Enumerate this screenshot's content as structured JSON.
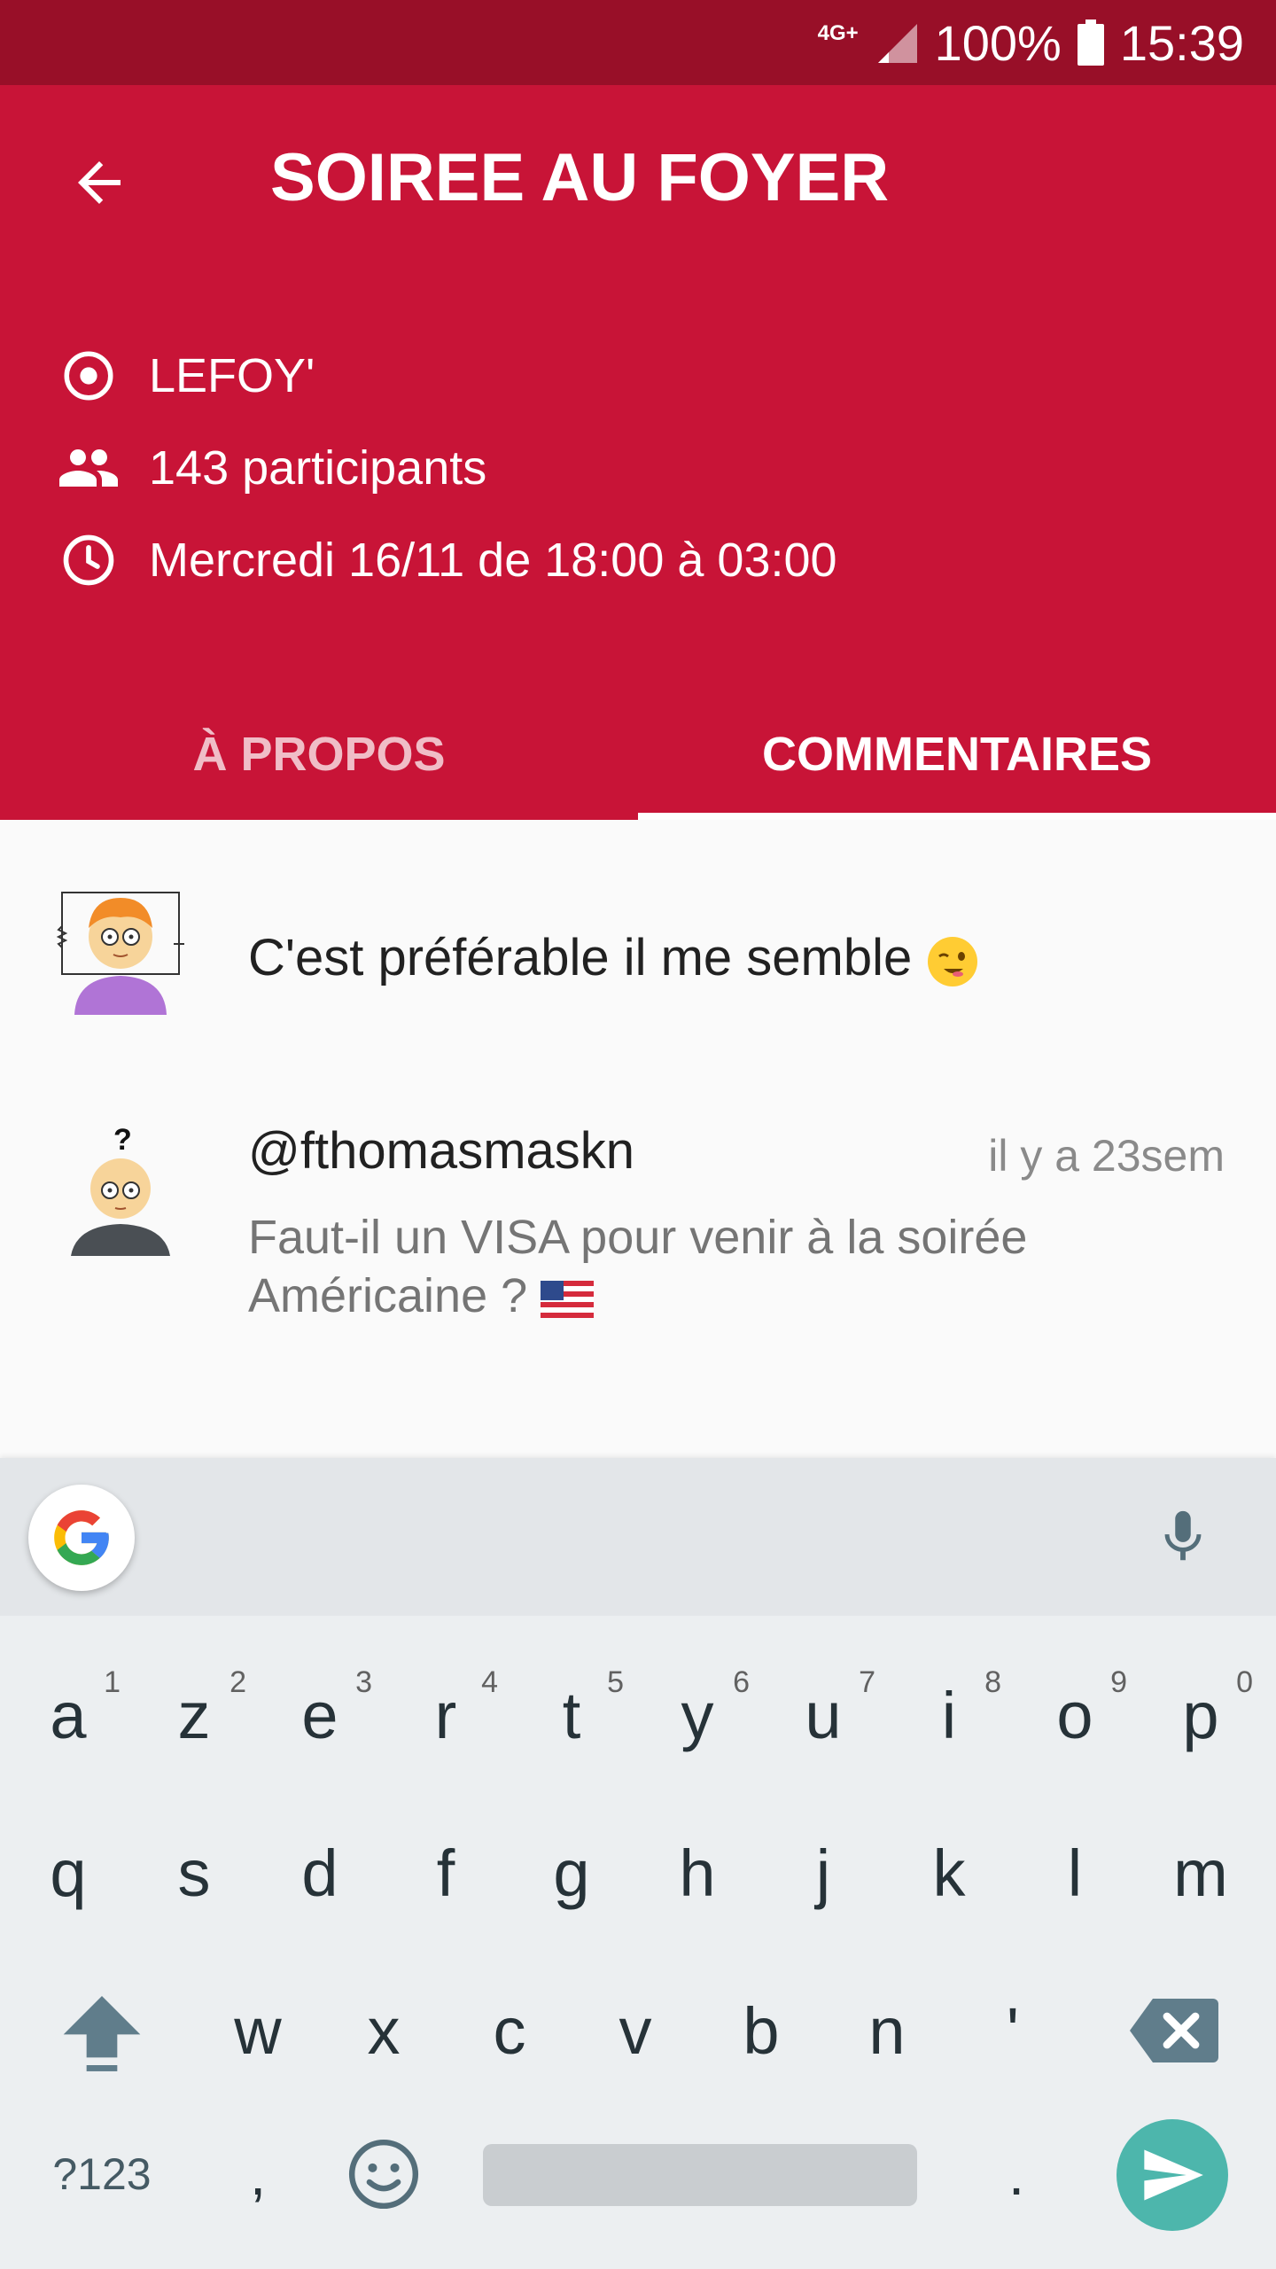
{
  "status_bar": {
    "network": "4G+",
    "battery": "100%",
    "time": "15:39"
  },
  "event": {
    "title": "SOIREE AU FOYER",
    "location": "LEFOY'",
    "participants": "143 participants",
    "schedule": "Mercredi 16/11 de 18:00 à 03:00"
  },
  "tabs": [
    {
      "label": "À PROPOS",
      "active": false
    },
    {
      "label": "COMMENTAIRES",
      "active": true
    }
  ],
  "comments": [
    {
      "text": "C'est préférable il me semble",
      "emoji": "winking-face"
    },
    {
      "author": "@fthomasmaskn",
      "time": "il y a 23sem",
      "text": "Faut-il un VISA pour venir à la soirée Américaine ?",
      "emoji": "us-flag"
    }
  ],
  "keyboard": {
    "row1": [
      {
        "k": "a",
        "h": "1"
      },
      {
        "k": "z",
        "h": "2"
      },
      {
        "k": "e",
        "h": "3"
      },
      {
        "k": "r",
        "h": "4"
      },
      {
        "k": "t",
        "h": "5"
      },
      {
        "k": "y",
        "h": "6"
      },
      {
        "k": "u",
        "h": "7"
      },
      {
        "k": "i",
        "h": "8"
      },
      {
        "k": "o",
        "h": "9"
      },
      {
        "k": "p",
        "h": "0"
      }
    ],
    "row2": [
      "q",
      "s",
      "d",
      "f",
      "g",
      "h",
      "j",
      "k",
      "l",
      "m"
    ],
    "row3": [
      "w",
      "x",
      "c",
      "v",
      "b",
      "n",
      "'"
    ],
    "symbols": "?123",
    "comma": ",",
    "period": "."
  },
  "colors": {
    "status_bar": "#980f28",
    "header": "#c81437",
    "send_button": "#4db6ac"
  }
}
